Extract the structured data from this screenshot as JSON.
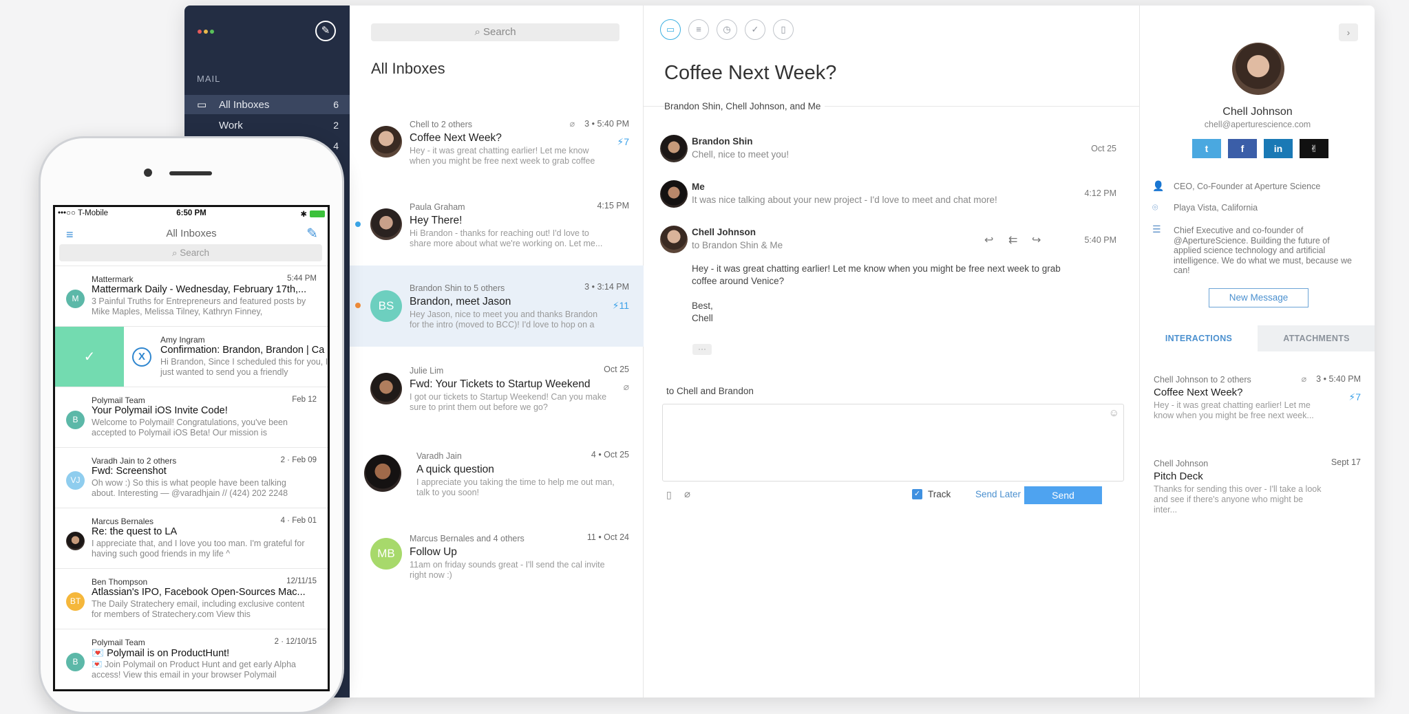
{
  "sidebar": {
    "section": "MAIL",
    "items": [
      {
        "label": "All Inboxes",
        "count": "6"
      },
      {
        "label": "Work",
        "count": "2"
      },
      {
        "label": "",
        "count": "4"
      }
    ]
  },
  "list": {
    "search_placeholder": "Search",
    "title": "All Inboxes",
    "mails": [
      {
        "from": "Chell to 2 others",
        "subject": "Coffee Next Week?",
        "preview": "Hey - it was great chatting earlier! Let me know when you might be free next week to grab coffee",
        "meta": "3 • 5:40 PM",
        "bolt": "⚡7"
      },
      {
        "from": "Paula Graham",
        "subject": "Hey There!",
        "preview": "Hi Brandon - thanks for reaching out! I'd love to share more about what we're working on. Let me...",
        "meta": "4:15 PM",
        "bolt": ""
      },
      {
        "from": "Brandon Shin to 5 others",
        "subject": "Brandon, meet Jason",
        "preview": "Hey Jason, nice to meet you and thanks Brandon for the intro (moved to BCC)! I'd love to hop on a",
        "meta": "3 • 3:14 PM",
        "bolt": "⚡11",
        "initials": "BS"
      },
      {
        "from": "Julie Lim",
        "subject": "Fwd: Your Tickets to Startup Weekend",
        "preview": "I got our tickets to Startup Weekend! Can you make sure to print them out before we go?",
        "meta": "Oct 25",
        "bolt": ""
      },
      {
        "from": "Varadh Jain",
        "subject": "A quick question",
        "preview": "I appreciate you taking the time to help me out man, talk to you soon!",
        "meta": "4 • Oct 25",
        "bolt": ""
      },
      {
        "from": "Marcus Bernales and 4 others",
        "subject": "Follow Up",
        "preview": "11am on friday sounds great - I'll send the cal invite right now :)",
        "meta": "11 • Oct 24",
        "bolt": "",
        "initials": "MB"
      }
    ]
  },
  "reader": {
    "subject": "Coffee Next Week?",
    "participants": "Brandon Shin, Chell Johnson, and Me",
    "messages": [
      {
        "name": "Brandon Shin",
        "sub": "Chell, nice to meet you!",
        "date": "Oct 25"
      },
      {
        "name": "Me",
        "sub": "It was nice talking about your new project - I'd love to meet and chat more!",
        "date": "4:12 PM"
      },
      {
        "name": "Chell Johnson",
        "sub": "to Brandon Shin & Me",
        "date": "5:40 PM"
      }
    ],
    "body": [
      "Hey - it was great chatting earlier! Let me know when you might be free next week to grab coffee around Venice?",
      "Best,",
      "Chell"
    ],
    "ellipsis": "···",
    "reply_to": "to Chell and Brandon",
    "track_label": "Track",
    "send_later": "Send Later",
    "send": "Send"
  },
  "profile": {
    "name": "Chell Johnson",
    "email": "chell@aperturescience.com",
    "social": {
      "twitter": "t",
      "facebook": "f",
      "linkedin": "in",
      "angellist": "✌"
    },
    "title": "CEO, Co-Founder at Aperture Science",
    "location": "Playa Vista, California",
    "bio": "Chief Executive and co-founder of @ApertureScience. Building the future of applied science technology and artificial intelligence. We do what we must, because we can!",
    "new_message": "New Message",
    "tabs": [
      "INTERACTIONS",
      "ATTACHMENTS"
    ],
    "interactions": [
      {
        "from": "Chell Johnson to 2 others",
        "subject": "Coffee Next Week?",
        "preview": "Hey - it was great chatting earlier! Let me know when you might be free next week...",
        "meta": "3 • 5:40 PM",
        "bolt": "⚡7"
      },
      {
        "from": "Chell Johnson",
        "subject": "Pitch Deck",
        "preview": "Thanks for sending this over - I'll take a look and see if there's anyone who might be inter...",
        "meta": "Sept 17",
        "bolt": ""
      }
    ]
  },
  "phone": {
    "carrier": "•••○○ T-Mobile",
    "time": "6:50 PM",
    "battery": "100%",
    "title": "All Inboxes",
    "search": "Search",
    "mails": [
      {
        "from": "Mattermark",
        "subject": "Mattermark Daily - Wednesday, February 17th,...",
        "preview": "3 Painful Truths for Entrepreneurs and featured posts by Mike Maples, Melissa Tilney, Kathryn Finney,",
        "date": "5:44 PM",
        "initials": "M"
      },
      {
        "from": "Amy Ingram",
        "subject": "Confirmation: Brandon, Brandon | Ca",
        "preview": "Hi Brandon, Since I scheduled this for you, I just wanted to send you a friendly",
        "date": "",
        "initials": "X"
      },
      {
        "from": "Polymail Team",
        "subject": "Your Polymail iOS Invite Code!",
        "preview": "Welcome to Polymail! Congratulations, you've been accepted to Polymail iOS Beta! Our mission is",
        "date": "Feb 12",
        "initials": "B"
      },
      {
        "from": "Varadh Jain to 2 others",
        "subject": "Fwd: Screenshot",
        "preview": "Oh wow :) So this is what people have been talking about. Interesting — @varadhjain // (424) 202 2248",
        "date": "2 · Feb 09",
        "initials": "VJ"
      },
      {
        "from": "Marcus Bernales",
        "subject": "Re: the quest to LA",
        "preview": "I appreciate that, and I love you too man. I'm grateful for having such good friends in my life ^",
        "date": "4 · Feb 01",
        "initials": ""
      },
      {
        "from": "Ben Thompson",
        "subject": "Atlassian's IPO, Facebook Open-Sources Mac...",
        "preview": "The Daily Stratechery email, including exclusive content for members of Stratechery.com View this",
        "date": "12/11/15",
        "initials": "BT"
      },
      {
        "from": "Polymail Team",
        "subject": "💌 Polymail is on ProductHunt!",
        "preview": "💌 Join Polymail on Product Hunt and get early Alpha access! View this email in your browser Polymail",
        "date": "2 · 12/10/15",
        "initials": "B"
      }
    ]
  }
}
